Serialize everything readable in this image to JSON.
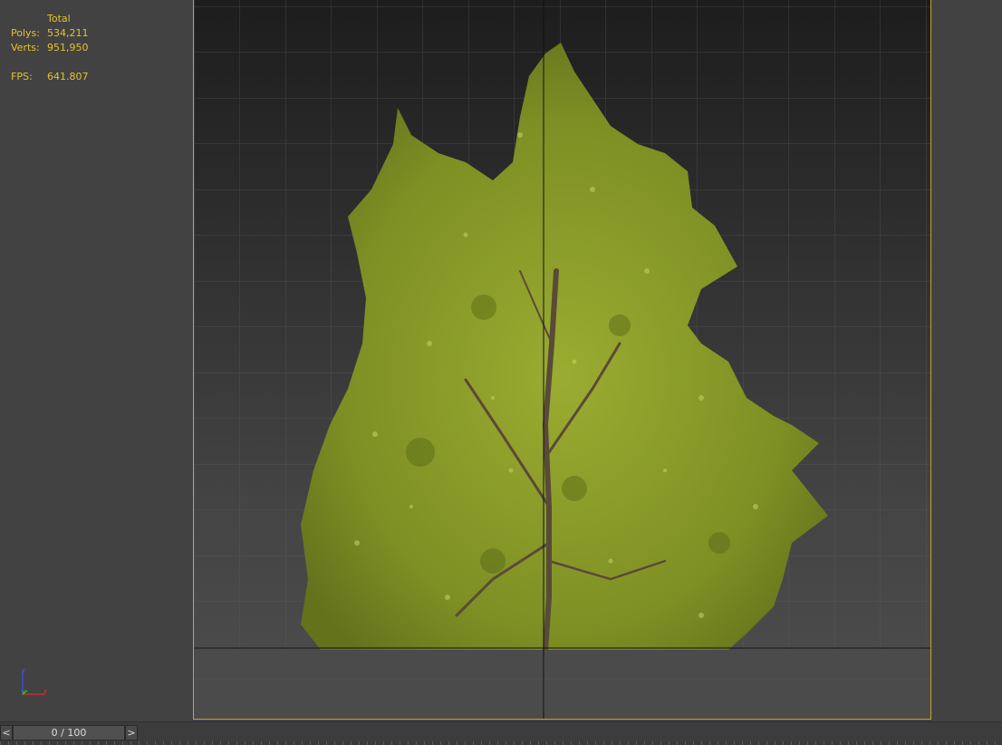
{
  "stats": {
    "header": "Total",
    "polys_label": "Polys:",
    "polys_value": "534,211",
    "verts_label": "Verts:",
    "verts_value": "951,950",
    "fps_label": "FPS:",
    "fps_value": "641.807"
  },
  "axis": {
    "z": "z",
    "y": "y",
    "x": "x"
  },
  "timeline": {
    "prev_label": "<",
    "frame_display": "0 / 100",
    "next_label": ">",
    "current_frame": 0,
    "total_frames": 100
  },
  "colors": {
    "stats_text": "#e6c229",
    "safe_frame_border": "#c9a526",
    "foliage": "#8a9a2a",
    "trunk": "#5a4a38"
  }
}
